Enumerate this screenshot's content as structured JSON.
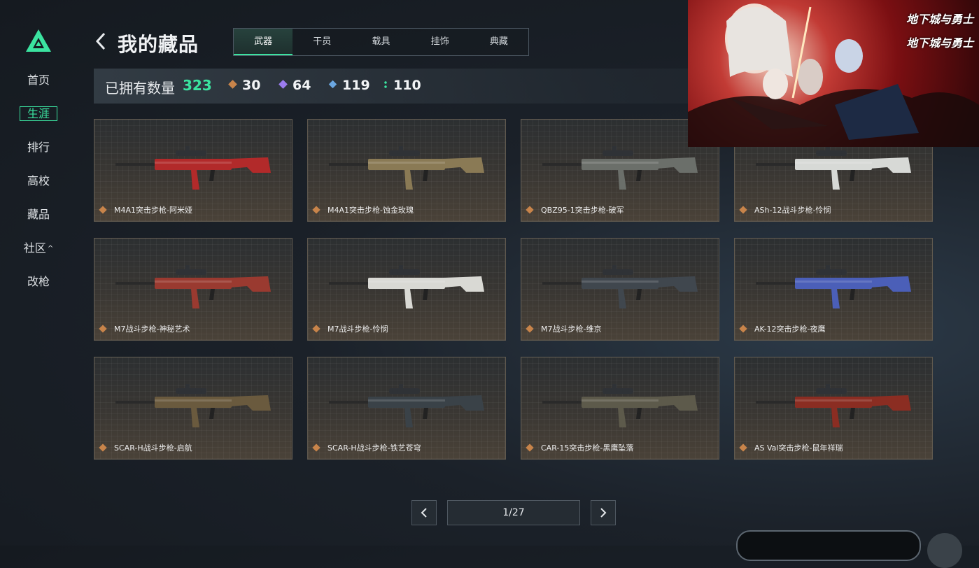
{
  "sidebar": {
    "items": [
      {
        "label": "首页",
        "active": false
      },
      {
        "label": "生涯",
        "active": true
      },
      {
        "label": "排行",
        "active": false
      },
      {
        "label": "高校",
        "active": false
      },
      {
        "label": "藏品",
        "active": false
      },
      {
        "label": "社区",
        "active": false,
        "caret": "^"
      },
      {
        "label": "改枪",
        "active": false
      }
    ]
  },
  "header": {
    "title": "我的藏品",
    "tabs": [
      "武器",
      "干员",
      "载具",
      "挂饰",
      "典藏"
    ],
    "active_tab": "武器"
  },
  "stats": {
    "label": "已拥有数量",
    "total": "323",
    "counts": [
      {
        "value": "30",
        "color": "#c8844a",
        "icon": "orange-diamond-icon"
      },
      {
        "value": "64",
        "color": "#9b7cf0",
        "icon": "purple-diamond-icon"
      },
      {
        "value": "119",
        "color": "#6aa6e0",
        "icon": "blue-diamond-icon"
      },
      {
        "value": "110",
        "color": "#3be3a0",
        "icon": "green-dots-icon"
      }
    ]
  },
  "items": [
    {
      "name": "M4A1突击步枪-阿米娅",
      "color": "#b22a2a"
    },
    {
      "name": "M4A1突击步枪-蚀金玫瑰",
      "color": "#8a7a55"
    },
    {
      "name": "QBZ95-1突击步枪-破军",
      "color": "#6b6f6a"
    },
    {
      "name": "ASh-12战斗步枪-怜悯",
      "color": "#d7d9d6"
    },
    {
      "name": "M7战斗步枪-神秘艺术",
      "color": "#9a3a30"
    },
    {
      "name": "M7战斗步枪-怜悯",
      "color": "#d9d9d4"
    },
    {
      "name": "M7战斗步枪-维京",
      "color": "#40474e"
    },
    {
      "name": "AK-12突击步枪-夜鹰",
      "color": "#4b5fb8"
    },
    {
      "name": "SCAR-H战斗步枪-启航",
      "color": "#6a5a3e"
    },
    {
      "name": "SCAR-H战斗步枪-铁艺苍穹",
      "color": "#3a4248"
    },
    {
      "name": "CAR-15突击步枪-黑鹰坠落",
      "color": "#5d5a4b"
    },
    {
      "name": "AS Val突击步枪-鼠年祥瑞",
      "color": "#8b2d22"
    }
  ],
  "pagination": {
    "text": "1/27"
  },
  "ad": {
    "logo_text": "地下城与勇士"
  },
  "accent_color": "#3be3a0"
}
